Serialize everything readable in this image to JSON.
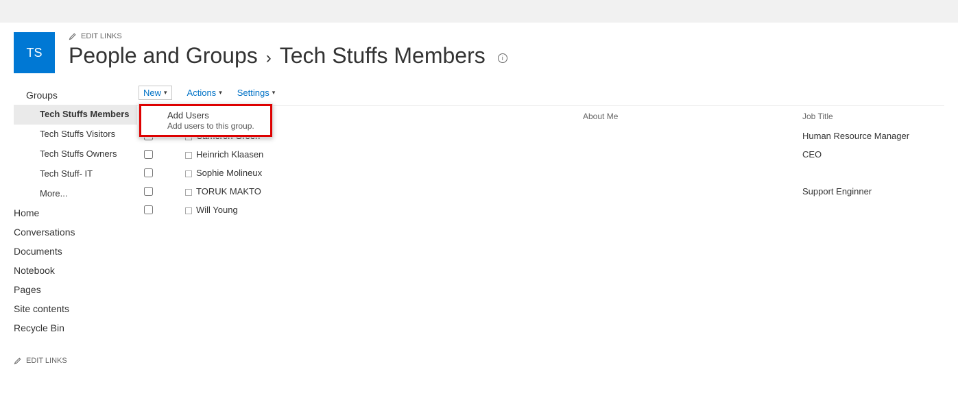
{
  "siteTile": "TS",
  "editLinksLabel": "EDIT LINKS",
  "title": "People and Groups",
  "subtitle": "Tech Stuffs Members",
  "sidebar": {
    "heading": "Groups",
    "groups": [
      {
        "label": "Tech Stuffs Members"
      },
      {
        "label": "Tech Stuffs Visitors"
      },
      {
        "label": "Tech Stuffs Owners"
      },
      {
        "label": "Tech Stuff- IT"
      },
      {
        "label": "More..."
      }
    ],
    "links": [
      {
        "label": "Home"
      },
      {
        "label": "Conversations"
      },
      {
        "label": "Documents"
      },
      {
        "label": "Notebook"
      },
      {
        "label": "Pages"
      },
      {
        "label": "Site contents"
      },
      {
        "label": "Recycle Bin"
      }
    ]
  },
  "toolbar": {
    "new": "New",
    "actions": "Actions",
    "settings": "Settings"
  },
  "dropdown": {
    "title": "Add Users",
    "subtitle": "Add users to this group."
  },
  "columns": {
    "about": "About Me",
    "job": "Job Title"
  },
  "rows": [
    {
      "name": "Cameron Green",
      "about": "",
      "job": "Human Resource Manager"
    },
    {
      "name": "Heinrich Klaasen",
      "about": "",
      "job": "CEO"
    },
    {
      "name": "Sophie Molineux",
      "about": "",
      "job": ""
    },
    {
      "name": "TORUK MAKTO",
      "about": "",
      "job": "Support Enginner"
    },
    {
      "name": "Will Young",
      "about": "",
      "job": ""
    }
  ]
}
